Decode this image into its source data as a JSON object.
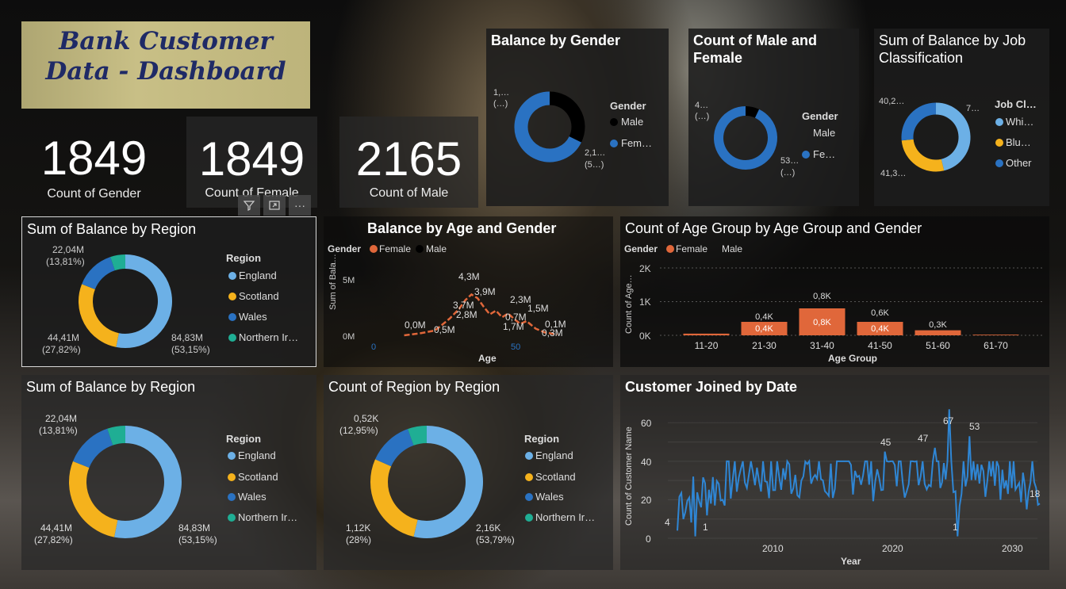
{
  "header": {
    "title_line1": "Bank Customer",
    "title_line2": "Data - Dashboard"
  },
  "kpis": [
    {
      "value": "1849",
      "label": "Count of Gender"
    },
    {
      "value": "1849",
      "label": "Count of Female"
    },
    {
      "value": "2165",
      "label": "Count of Male"
    }
  ],
  "toolbar": {
    "filter_icon": "filter-icon",
    "focus_icon": "focus-mode-icon",
    "more_icon": "more-options-icon",
    "more_label": "···"
  },
  "colors": {
    "england": "#6cb0e6",
    "scotland": "#f5b21c",
    "wales": "#2a72c2",
    "northern_ireland": "#1fae94",
    "female": "#e0673a",
    "male": "#000000",
    "line_blue": "#2f86d4"
  },
  "panels": {
    "balance_by_gender": {
      "title": "Balance by Gender",
      "legend_title": "Gender",
      "legend": [
        "Male",
        "Fem…"
      ],
      "labels": [
        "1,…",
        "(…)",
        "2,1…",
        "(5…)"
      ]
    },
    "count_male_female": {
      "title_line1": "Count of Male and",
      "title_line2": "Female",
      "legend_title": "Gender",
      "legend": [
        "Male",
        "Fe…"
      ],
      "labels": [
        "4…",
        "(…)",
        "53…",
        "(…)"
      ]
    },
    "balance_by_job": {
      "title_line1": "Sum of Balance by Job",
      "title_line2": "Classification",
      "legend_title": "Job Cl…",
      "legend": [
        "Whi…",
        "Blu…",
        "Other"
      ],
      "labels": [
        "40,2…",
        "7…",
        "41,3…"
      ]
    },
    "region1": {
      "title": "Sum of Balance by Region",
      "legend_title": "Region",
      "legend": [
        "England",
        "Scotland",
        "Wales",
        "Northern Ir…"
      ],
      "labels": [
        "22,04M",
        "(13,81%)",
        "44,41M",
        "(27,82%)",
        "84,83M",
        "(53,15%)"
      ]
    },
    "age_gender": {
      "title": "Balance by Age and Gender",
      "legend_title": "Gender",
      "legend": [
        "Female",
        "Male"
      ],
      "ylabel": "Sum of Bala…",
      "xlabel": "Age",
      "yticks": [
        "5M",
        "0M"
      ],
      "xticks": [
        "0",
        "50"
      ],
      "data_labels": [
        "4,3M",
        "3,9M",
        "3,7M",
        "2,8M",
        "2,3M",
        "1,5M",
        "0,0M",
        "0,5M",
        "0,7M",
        "1,7M",
        "0,1M",
        "0,3M"
      ]
    },
    "age_group": {
      "title": "Count of Age Group by Age Group and Gender",
      "legend_title": "Gender",
      "legend": [
        "Female",
        "Male"
      ],
      "ylabel": "Count of Age…",
      "xlabel": "Age Group",
      "yticks": [
        "2K",
        "1K",
        "0K"
      ]
    },
    "region2": {
      "title": "Sum of Balance by Region",
      "legend_title": "Region",
      "legend": [
        "England",
        "Scotland",
        "Wales",
        "Northern Ir…"
      ],
      "labels": [
        "22,04M",
        "(13,81%)",
        "44,41M",
        "(27,82%)",
        "84,83M",
        "(53,15%)"
      ]
    },
    "region_count": {
      "title": "Count of Region by Region",
      "legend_title": "Region",
      "legend": [
        "England",
        "Scotland",
        "Wales",
        "Northern Ir…"
      ],
      "labels": [
        "0,52K",
        "(12,95%)",
        "1,12K",
        "(28%)",
        "2,16K",
        "(53,79%)"
      ]
    },
    "joined": {
      "title": "Customer Joined by Date",
      "ylabel": "Count of Customer Name",
      "xlabel": "Year",
      "yticks": [
        "60",
        "40",
        "20",
        "0"
      ],
      "xticks": [
        "2010",
        "2020",
        "2030"
      ],
      "data_labels": [
        "4",
        "1",
        "45",
        "47",
        "67",
        "53",
        "1",
        "18"
      ]
    }
  },
  "chart_data": [
    {
      "type": "pie",
      "title": "Balance by Gender",
      "legend_title": "Gender",
      "categories": [
        "Male",
        "Female"
      ],
      "values": [
        1,
        2.1
      ],
      "colors": [
        "#000000",
        "#2a72c2"
      ]
    },
    {
      "type": "pie",
      "title": "Count of Male and Female",
      "legend_title": "Gender",
      "categories": [
        "Male",
        "Female"
      ],
      "values": [
        4,
        53
      ],
      "colors": [
        "#000000",
        "#2a72c2"
      ]
    },
    {
      "type": "pie",
      "title": "Sum of Balance by Job Classification",
      "legend_title": "Job Classification",
      "categories": [
        "White Collar",
        "Blue Collar",
        "Other"
      ],
      "values": [
        70,
        41.3,
        40.2
      ],
      "colors": [
        "#6cb0e6",
        "#f5b21c",
        "#2a72c2"
      ]
    },
    {
      "type": "pie",
      "title": "Sum of Balance by Region",
      "legend_title": "Region",
      "categories": [
        "England",
        "Scotland",
        "Wales",
        "Northern Ireland"
      ],
      "values": [
        84.83,
        44.41,
        22.04,
        8.3
      ],
      "colors": [
        "#6cb0e6",
        "#f5b21c",
        "#2a72c2",
        "#1fae94"
      ]
    },
    {
      "type": "line",
      "title": "Balance by Age and Gender",
      "xlabel": "Age",
      "ylabel": "Sum of Balance",
      "x": [
        10,
        15,
        20,
        22,
        25,
        28,
        30,
        32,
        34,
        36,
        38,
        40,
        42,
        44,
        46,
        48,
        50,
        53,
        56,
        60
      ],
      "series": [
        {
          "name": "Female",
          "values": [
            0.0,
            0.2,
            0.5,
            1.0,
            1.8,
            2.8,
            3.7,
            4.3,
            3.9,
            3.0,
            2.2,
            2.6,
            1.9,
            2.3,
            1.7,
            1.2,
            1.5,
            0.7,
            0.3,
            0.1
          ]
        }
      ],
      "ylim": [
        0,
        6
      ],
      "xlim": [
        0,
        70
      ]
    },
    {
      "type": "bar",
      "title": "Count of Age Group by Age Group and Gender",
      "xlabel": "Age Group",
      "ylabel": "Count of Age Group",
      "categories": [
        "11-20",
        "21-30",
        "31-40",
        "41-50",
        "51-60",
        "61-70"
      ],
      "series": [
        {
          "name": "Female",
          "values": [
            0.05,
            0.4,
            0.8,
            0.4,
            0.15,
            0.02
          ]
        },
        {
          "name": "Male",
          "values": [
            0.05,
            0.4,
            0.8,
            0.6,
            0.3,
            0.02
          ]
        }
      ],
      "data_labels": [
        "0,4K",
        "0,4K",
        "0,8K",
        "0,8K",
        "0,6K",
        "0,4K",
        "0,3K"
      ],
      "ylim": [
        0,
        2
      ]
    },
    {
      "type": "pie",
      "title": "Sum of Balance by Region",
      "legend_title": "Region",
      "categories": [
        "England",
        "Scotland",
        "Wales",
        "Northern Ireland"
      ],
      "values": [
        84.83,
        44.41,
        22.04,
        8.3
      ],
      "colors": [
        "#6cb0e6",
        "#f5b21c",
        "#2a72c2",
        "#1fae94"
      ]
    },
    {
      "type": "pie",
      "title": "Count of Region by Region",
      "legend_title": "Region",
      "categories": [
        "England",
        "Scotland",
        "Wales",
        "Northern Ireland"
      ],
      "values": [
        2.16,
        1.12,
        0.52,
        0.22
      ],
      "colors": [
        "#6cb0e6",
        "#f5b21c",
        "#2a72c2",
        "#1fae94"
      ]
    },
    {
      "type": "line",
      "title": "Customer Joined by Date",
      "xlabel": "Year",
      "ylabel": "Count of Customer Name",
      "xlim": [
        2001,
        2032
      ],
      "ylim": [
        0,
        70
      ],
      "x": [
        2001.8,
        2003.3,
        2005.6,
        2007.8,
        2010.0,
        2012.2,
        2014.5,
        2016.7,
        2018.9,
        2019.2,
        2021.2,
        2022.2,
        2023.4,
        2024.0,
        2024.6,
        2025.3,
        2026.3,
        2027.8,
        2028.9,
        2030.0,
        2031.1,
        2032.2
      ],
      "series": [
        {
          "name": "Count",
          "values": [
            4,
            1,
            20,
            33,
            25,
            30,
            22,
            35,
            25,
            45,
            28,
            32,
            47,
            29,
            67,
            1,
            53,
            30,
            20,
            40,
            15,
            18
          ]
        }
      ]
    }
  ]
}
